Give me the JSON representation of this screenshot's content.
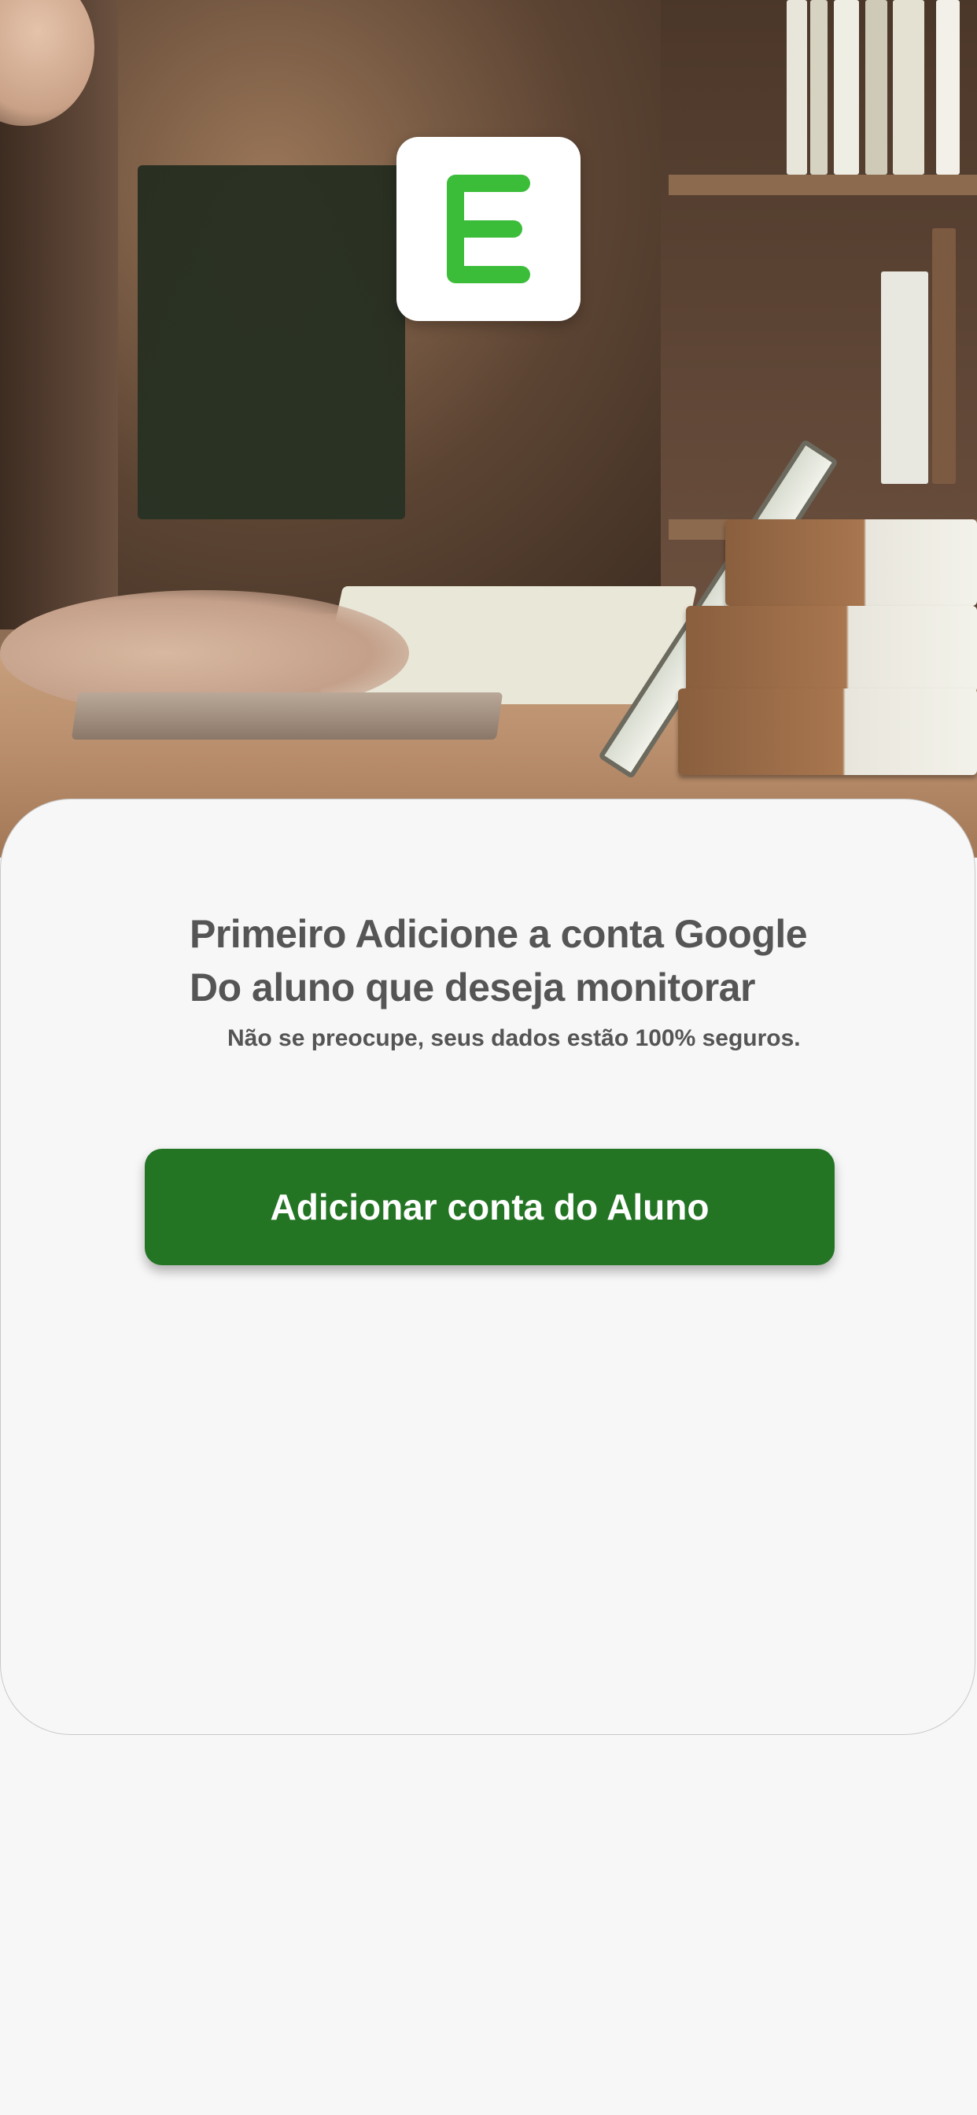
{
  "app": {
    "logo_letter": "E",
    "logo_color": "#3bbd3a",
    "logo_background": "#ffffff"
  },
  "hero": {
    "image_semantic": "hero-study-photo"
  },
  "card": {
    "title_line_1": "Primeiro Adicione a conta Google",
    "title_line_2": "Do aluno que deseja monitorar",
    "subtitle": "Não se preocupe, seus dados estão 100% seguros.",
    "text_color": "#555555"
  },
  "actions": {
    "add_student_account_label": "Adicionar conta do Aluno",
    "primary_color": "#237524"
  }
}
